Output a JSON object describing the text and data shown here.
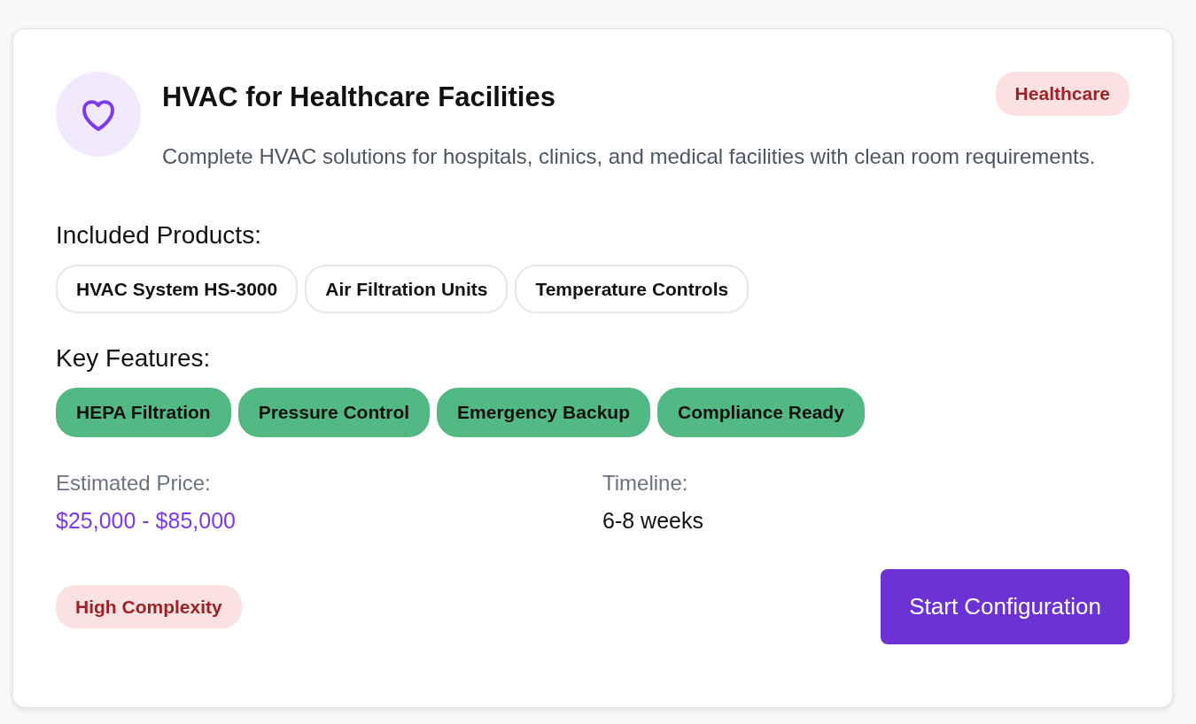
{
  "card": {
    "title": "HVAC for Healthcare Facilities",
    "category": "Healthcare",
    "description": "Complete HVAC solutions for hospitals, clinics, and medical facilities with clean room requirements.",
    "products_heading": "Included Products:",
    "products": [
      "HVAC System HS-3000",
      "Air Filtration Units",
      "Temperature Controls"
    ],
    "features_heading": "Key Features:",
    "features": [
      "HEPA Filtration",
      "Pressure Control",
      "Emergency Backup",
      "Compliance Ready"
    ],
    "price": {
      "label": "Estimated Price:",
      "value": "$25,000 - $85,000"
    },
    "timeline": {
      "label": "Timeline:",
      "value": "6-8 weeks"
    },
    "complexity": "High Complexity",
    "button": "Start Configuration"
  }
}
